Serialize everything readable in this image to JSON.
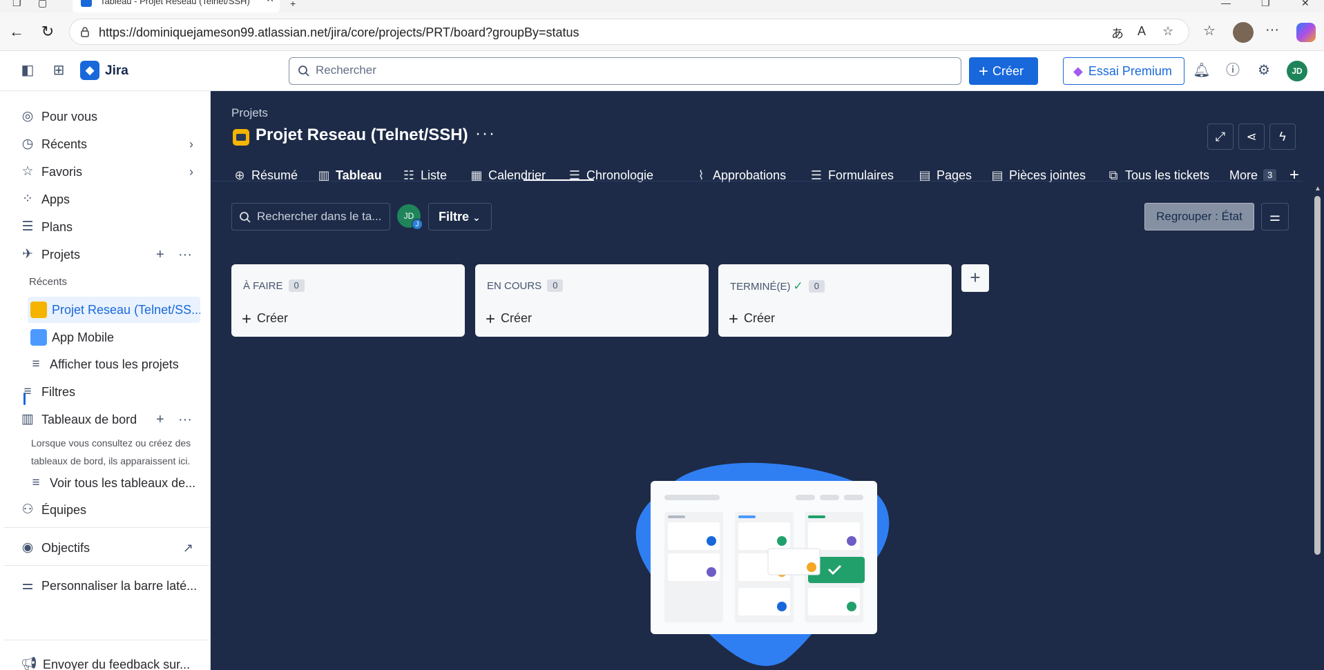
{
  "browser": {
    "tab_title": "Tableau - Projet Reseau (Telnet/SSH)",
    "url": "https://dominiquejameson99.atlassian.net/jira/core/projects/PRT/board?groupBy=status"
  },
  "topbar": {
    "app_name": "Jira",
    "search_placeholder": "Rechercher",
    "create_label": "Créer",
    "premium_label": "Essai Premium",
    "avatar_initials": "JD"
  },
  "sidebar": {
    "for_you": "Pour vous",
    "recent": "Récents",
    "favorites": "Favoris",
    "apps": "Apps",
    "plans": "Plans",
    "projects": "Projets",
    "recent_sub": "Récents",
    "project_active": "Projet Reseau (Telnet/SS...",
    "project_app": "App Mobile",
    "all_projects": "Afficher tous les projets",
    "filters": "Filtres",
    "dashboards": "Tableaux de bord",
    "dashboards_note": "Lorsque vous consultez ou créez des tableaux de bord, ils apparaissent ici.",
    "all_dashboards": "Voir tous les tableaux de...",
    "teams": "Équipes",
    "goals": "Objectifs",
    "customize": "Personnaliser la barre laté...",
    "feedback": "Envoyer du feedback sur..."
  },
  "project": {
    "breadcrumb": "Projets",
    "title": "Projet Reseau (Telnet/SSH)",
    "more": "···"
  },
  "tabs": [
    {
      "label": "Résumé",
      "icon": "globe-icon"
    },
    {
      "label": "Tableau",
      "icon": "board-icon"
    },
    {
      "label": "Liste",
      "icon": "list-icon"
    },
    {
      "label": "Calendrier",
      "icon": "calendar-icon"
    },
    {
      "label": "Chronologie",
      "icon": "timeline-icon"
    },
    {
      "label": "Approbations",
      "icon": "paperclip-icon"
    },
    {
      "label": "Formulaires",
      "icon": "forms-icon"
    },
    {
      "label": "Pages",
      "icon": "page-icon"
    },
    {
      "label": "Pièces jointes",
      "icon": "attachment-icon"
    },
    {
      "label": "Tous les tickets",
      "icon": "tickets-icon"
    },
    {
      "label": "More",
      "icon": "",
      "badge": "3"
    }
  ],
  "board": {
    "search_placeholder": "Rechercher dans le ta...",
    "avatar_initials": "JD",
    "avatar_mini": "J",
    "filter_label": "Filtre",
    "group_label": "Regrouper : État",
    "columns": [
      {
        "title": "À FAIRE",
        "count": "0",
        "create": "Créer"
      },
      {
        "title": "EN COURS",
        "count": "0",
        "create": "Créer"
      },
      {
        "title": "TERMINÉ(E)",
        "count": "0",
        "create": "Créer"
      }
    ]
  },
  "colors": {
    "accent": "#1868db",
    "board_bg": "#1d2b48",
    "done_green": "#22a06b"
  }
}
